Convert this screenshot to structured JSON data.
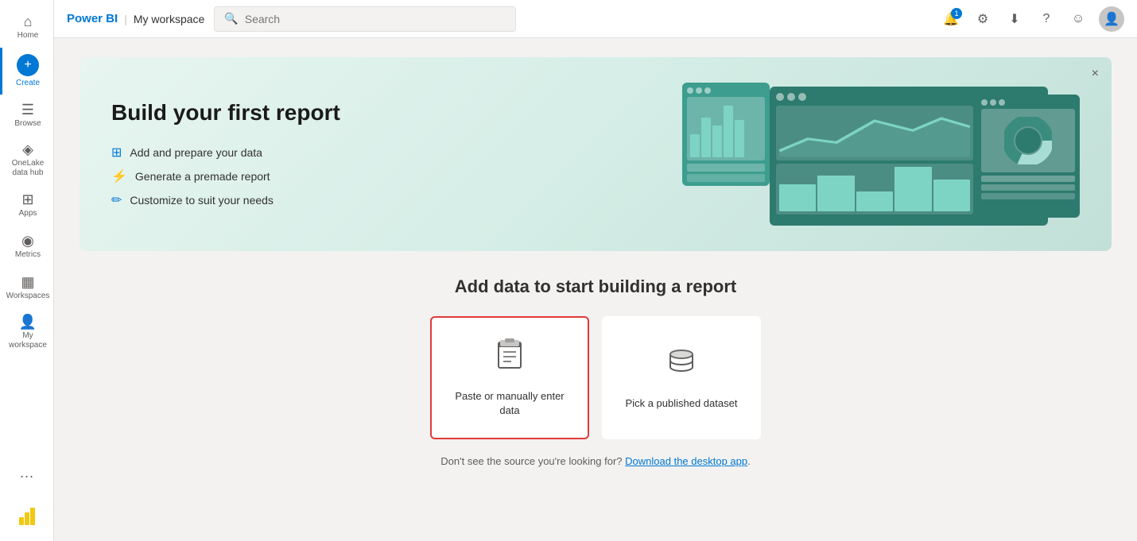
{
  "app": {
    "brand": "Power BI",
    "workspace": "My workspace"
  },
  "topbar": {
    "search_placeholder": "Search",
    "notification_count": "1",
    "icons": {
      "settings": "⚙",
      "download": "⬇",
      "help": "?",
      "feedback": "☺"
    }
  },
  "sidebar": {
    "items": [
      {
        "id": "home",
        "label": "Home",
        "icon": "⌂"
      },
      {
        "id": "create",
        "label": "Create",
        "icon": "+"
      },
      {
        "id": "browse",
        "label": "Browse",
        "icon": "☰"
      },
      {
        "id": "datalake",
        "label": "OneLake data hub",
        "icon": "◈"
      },
      {
        "id": "apps",
        "label": "Apps",
        "icon": "⊞"
      },
      {
        "id": "metrics",
        "label": "Metrics",
        "icon": "◉"
      },
      {
        "id": "workspaces",
        "label": "Workspaces",
        "icon": "▦"
      },
      {
        "id": "myworkspace",
        "label": "My workspace",
        "icon": "👤"
      }
    ],
    "more_label": "···",
    "powerbi_label": "Power BI"
  },
  "hero": {
    "title": "Build your first report",
    "features": [
      {
        "icon": "⊞",
        "text": "Add and prepare your data"
      },
      {
        "icon": "⚡",
        "text": "Generate a premade report"
      },
      {
        "icon": "⊟",
        "text": "Customize to suit your needs"
      }
    ],
    "close_label": "×"
  },
  "add_data": {
    "title": "Add data to start building a report",
    "options": [
      {
        "id": "paste",
        "label": "Paste or manually enter data",
        "icon": "⊞",
        "selected": true
      },
      {
        "id": "dataset",
        "label": "Pick a published dataset",
        "icon": "📊",
        "selected": false
      }
    ],
    "bottom_note": "Don't see the source you're looking for?",
    "download_link": "Download the desktop app",
    "bottom_note_suffix": "."
  }
}
